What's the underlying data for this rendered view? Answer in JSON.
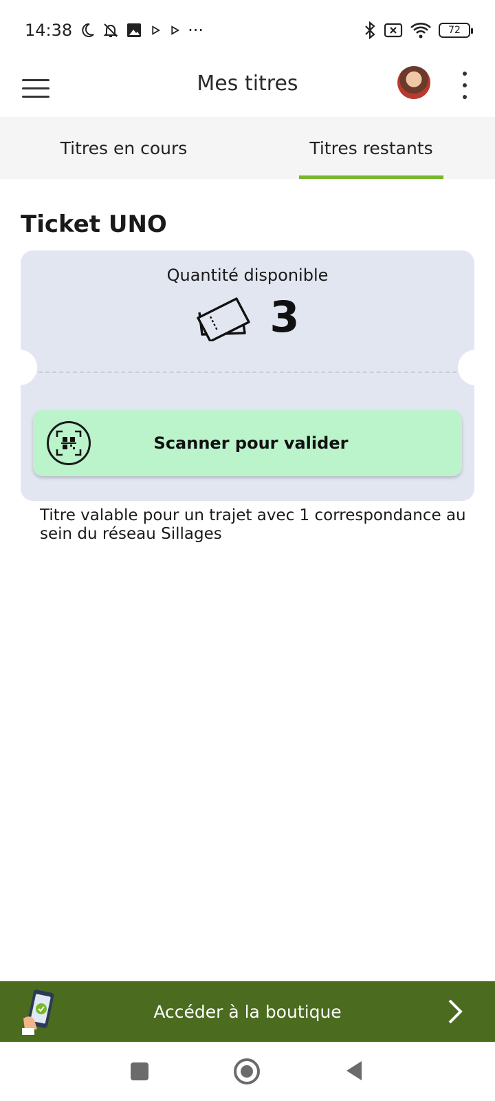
{
  "status_bar": {
    "time": "14:38",
    "more": "···",
    "battery": "72"
  },
  "app_bar": {
    "title": "Mes titres"
  },
  "tabs": [
    {
      "label": "Titres en cours",
      "active": false
    },
    {
      "label": "Titres restants",
      "active": true
    }
  ],
  "ticket": {
    "name": "Ticket UNO",
    "quantity_label": "Quantité disponible",
    "quantity": "3",
    "scan_label": "Scanner pour valider",
    "description": "Titre valable pour un trajet avec 1 correspondance au sein du réseau Sillages"
  },
  "shop": {
    "label": "Accéder à la boutique"
  },
  "colors": {
    "accent_green": "#76b82a",
    "shop_bar": "#4b6b1f",
    "scan_button": "#bbf3cb",
    "ticket_card": "#e2e6f1"
  }
}
